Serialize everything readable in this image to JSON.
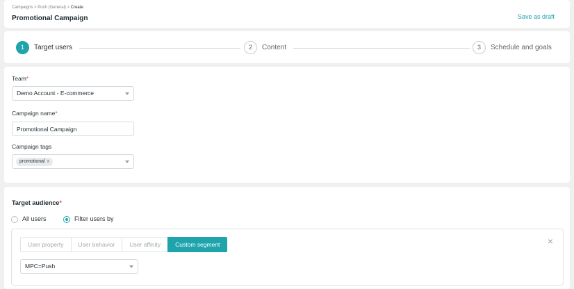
{
  "header": {
    "breadcrumb": [
      "Campaigns",
      "Push (General)",
      "Create"
    ],
    "breadcrumb_sep": ">",
    "title": "Promotional Campaign",
    "save_draft": "Save as draft"
  },
  "stepper": {
    "steps": [
      {
        "num": "1",
        "label": "Target users",
        "active": true
      },
      {
        "num": "2",
        "label": "Content",
        "active": false
      },
      {
        "num": "3",
        "label": "Schedule and goals",
        "active": false
      }
    ]
  },
  "form": {
    "team_label": "Team",
    "team_value": "Demo Account - E-commerce",
    "name_label": "Campaign name",
    "name_value": "Promotional Campaign",
    "tags_label": "Campaign tags",
    "tags": [
      "promotional"
    ],
    "required_mark": "*",
    "chip_remove": "x"
  },
  "audience": {
    "title": "Target audience",
    "options": [
      {
        "label": "All users",
        "checked": false
      },
      {
        "label": "Filter users by",
        "checked": true
      }
    ],
    "tabs": [
      {
        "label": "User property",
        "active": false
      },
      {
        "label": "User behavior",
        "active": false
      },
      {
        "label": "User affinity",
        "active": false
      },
      {
        "label": "Custom segment",
        "active": true
      }
    ],
    "close": "×",
    "segment_value": "MPC=Push"
  },
  "colors": {
    "accent": "#1fa3ad",
    "required": "#d9534f"
  }
}
